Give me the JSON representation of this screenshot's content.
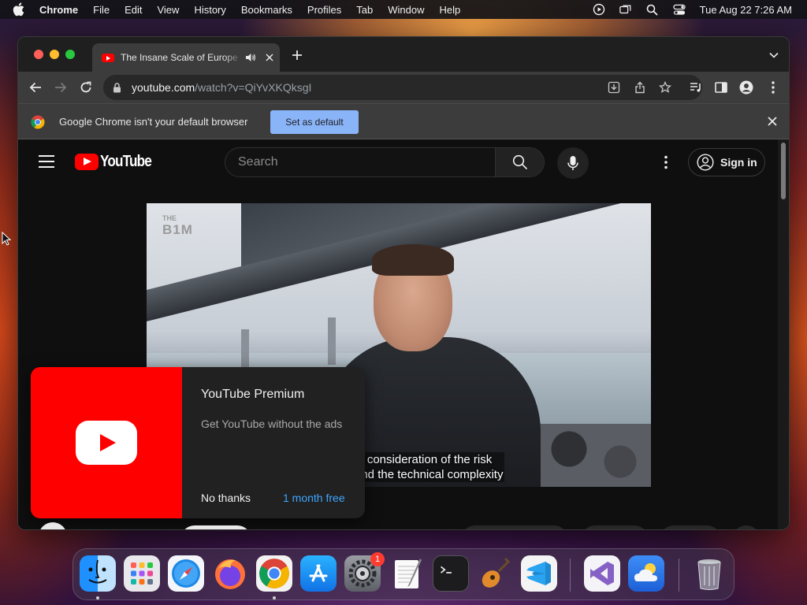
{
  "menubar": {
    "app_name": "Chrome",
    "items": [
      "File",
      "Edit",
      "View",
      "History",
      "Bookmarks",
      "Profiles",
      "Tab",
      "Window",
      "Help"
    ],
    "clock": "Tue Aug 22  7:26 AM",
    "status_icons": [
      "screen-recording-icon",
      "screen-mirroring-icon",
      "spotlight-search-icon",
      "control-center-icon"
    ]
  },
  "browser": {
    "tab": {
      "title": "The Insane Scale of Europe",
      "favicon": "youtube-favicon-icon",
      "audio": "speaker-icon"
    },
    "url_host": "youtube.com",
    "url_path": "/watch?v=QiYvXKQksgI",
    "infobar": {
      "message": "Google Chrome isn't your default browser",
      "button": "Set as default"
    }
  },
  "youtube": {
    "logo_text": "YouTube",
    "search_placeholder": "Search",
    "sign_in": "Sign in",
    "video": {
      "watermark_top": "THE",
      "watermark_bottom": "B1M",
      "caption_line1": "ul consideration of the risk",
      "caption_line2": "and the technical complexity"
    },
    "premium": {
      "title": "YouTube Premium",
      "subtitle": "Get YouTube without the ads",
      "dismiss": "No thanks",
      "cta": "1 month free"
    }
  },
  "dock": {
    "apps": [
      "Finder",
      "Launchpad",
      "Safari",
      "Firefox",
      "Google Chrome",
      "App Store",
      "System Settings",
      "TextEdit",
      "Terminal",
      "GarageBand",
      "Visual Studio Code",
      "Visual Studio",
      "Weather",
      "Trash"
    ],
    "settings_badge": "1"
  },
  "colors": {
    "youtube_red": "#ff0000",
    "chrome_blue": "#8ab4f8",
    "link_blue": "#3ea6ff"
  }
}
